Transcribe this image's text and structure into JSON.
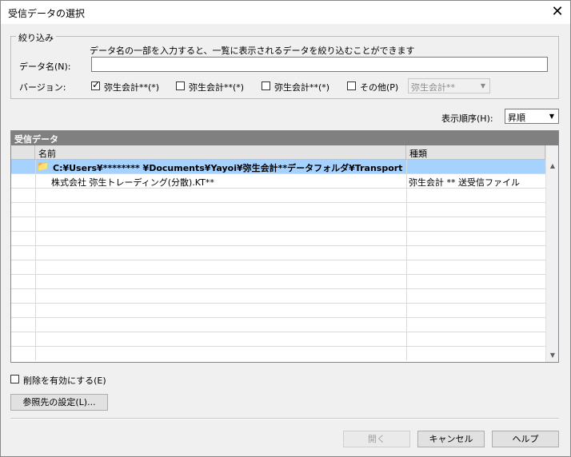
{
  "window": {
    "title": "受信データの選択",
    "close_glyph": "✕"
  },
  "filter": {
    "group_label": "絞り込み",
    "hint": "データ名の一部を入力すると、一覧に表示されるデータを絞り込むことができます",
    "name_label": "データ名(N):",
    "name_value": "",
    "version_label": "バージョン:",
    "versions": [
      {
        "label": "弥生会計**(*)",
        "checked": true
      },
      {
        "label": "弥生会計**(*)",
        "checked": false
      },
      {
        "label": "弥生会計**(*)",
        "checked": false
      },
      {
        "label": "その他(P)",
        "checked": false
      }
    ],
    "other_combo_value": "弥生会計**"
  },
  "sort": {
    "label": "表示順序(H):",
    "value": "昇順"
  },
  "grid": {
    "title": "受信データ",
    "columns": [
      "名前",
      "種類"
    ],
    "rows": [
      {
        "name": "C:¥Users¥******** ¥Documents¥Yayoi¥弥生会計**データフォルダ¥Transport",
        "type": "",
        "icon": "folder-icon",
        "selected": true
      },
      {
        "name": "株式会社 弥生トレーディング(分散).KT**",
        "type": "弥生会計 ** 送受信ファイル",
        "selected": false
      }
    ],
    "scroll_up": "▲",
    "scroll_down": "▼"
  },
  "delete_enable": {
    "label": "削除を有効にする(E)",
    "checked": false
  },
  "buttons": {
    "ref_settings": "参照先の設定(L)...",
    "open": "開く",
    "cancel": "キャンセル",
    "help": "ヘルプ"
  }
}
